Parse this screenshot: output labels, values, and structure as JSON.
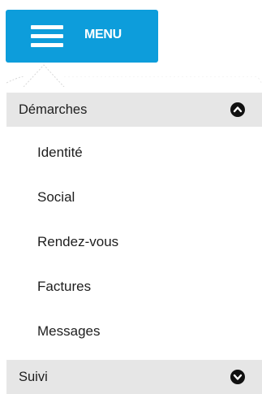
{
  "menu_button": {
    "label": "MENU",
    "icon": "hamburger-icon",
    "color": "#0d9ddb"
  },
  "sections": [
    {
      "label": "Démarches",
      "expanded": true,
      "toggle_icon": "chevron-up-circle-icon",
      "items": [
        {
          "label": "Identité"
        },
        {
          "label": "Social"
        },
        {
          "label": "Rendez-vous"
        },
        {
          "label": "Factures"
        },
        {
          "label": "Messages"
        }
      ]
    },
    {
      "label": "Suivi",
      "expanded": false,
      "toggle_icon": "chevron-down-circle-icon",
      "items": []
    }
  ],
  "colors": {
    "header_bg": "#e6e6e6",
    "text": "#1e1e1e",
    "toggle": "#111111"
  }
}
